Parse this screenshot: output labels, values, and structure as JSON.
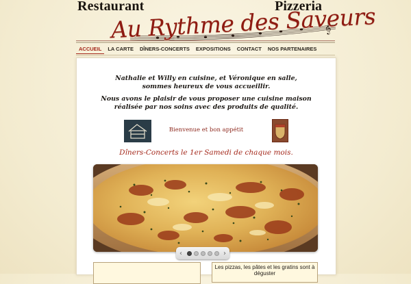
{
  "header": {
    "brand_left": "Restaurant",
    "brand_right": "Pizzeria",
    "brand_main": "Au Rythme des Saveurs"
  },
  "nav": {
    "items": [
      {
        "label": "ACCUEIL",
        "active": true
      },
      {
        "label": "LA CARTE",
        "active": false
      },
      {
        "label": "DÎNERS-CONCERTS",
        "active": false
      },
      {
        "label": "EXPOSITIONS",
        "active": false
      },
      {
        "label": "CONTACT",
        "active": false
      },
      {
        "label": "NOS PARTENAIRES",
        "active": false
      }
    ]
  },
  "intro": {
    "line1": "Nathalie et Willy en cuisine, et Véronique en salle,",
    "line2": "sommes heureux de vous accueillir.",
    "line3": "Nous avons le plaisir de vous proposer une cuisine maison",
    "line4": "réalisée par nos soins avec des produits de qualité."
  },
  "welcome": "Bienvenue et bon appétit",
  "concerts": "Dîners-Concerts le 1er Samedi de chaque mois.",
  "slider": {
    "prev_icon": "chevron-left-icon",
    "next_icon": "chevron-right-icon",
    "slide_count": 5,
    "active_slide": 1
  },
  "right_box": {
    "text_line1": "Les pizzas, les pâtes et les gratins sont à",
    "text_line2": "déguster"
  },
  "colors": {
    "accent": "#a4281b",
    "background": "#f5efd9",
    "house_tile": "#2a3c47"
  }
}
